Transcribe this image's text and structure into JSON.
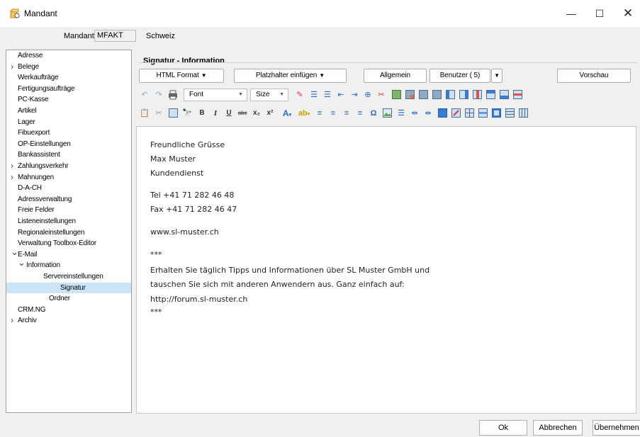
{
  "window": {
    "title": "Mandant",
    "minimize_glyph": "—",
    "maximize_glyph": "☐",
    "close_glyph": "✕"
  },
  "mandant": {
    "label": "Mandant",
    "value": "MFAKT",
    "country": "Schweiz"
  },
  "tree": {
    "items": [
      {
        "label": "Adresse",
        "expander": ""
      },
      {
        "label": "Belege",
        "expander": ">"
      },
      {
        "label": "Werkaufträge",
        "expander": ""
      },
      {
        "label": "Fertigungsaufträge",
        "expander": ""
      },
      {
        "label": "PC-Kasse",
        "expander": ""
      },
      {
        "label": "Artikel",
        "expander": ""
      },
      {
        "label": "Lager",
        "expander": ""
      },
      {
        "label": "Fibuexport",
        "expander": ""
      },
      {
        "label": "OP-Einstellungen",
        "expander": ""
      },
      {
        "label": "Bankassistent",
        "expander": ""
      },
      {
        "label": "Zahlungsverkehr",
        "expander": ">"
      },
      {
        "label": "Mahnungen",
        "expander": ">"
      },
      {
        "label": "D-A-CH",
        "expander": ""
      },
      {
        "label": "Adressverwaltung",
        "expander": ""
      },
      {
        "label": "Freie Felder",
        "expander": ""
      },
      {
        "label": "Listeneinstellungen",
        "expander": ""
      },
      {
        "label": "Regionaleinstellungen",
        "expander": ""
      },
      {
        "label": "Verwaltung Toolbox-Editor",
        "expander": ""
      },
      {
        "label": "E-Mail",
        "expander": "v"
      },
      {
        "label": "Information",
        "expander": "v"
      },
      {
        "label": "Servereinstellungen",
        "expander": ""
      },
      {
        "label": "Signatur",
        "expander": ""
      },
      {
        "label": "Ordner",
        "expander": ""
      },
      {
        "label": "CRM.NG",
        "expander": ""
      },
      {
        "label": "Archiv",
        "expander": ">"
      }
    ],
    "selected": "Signatur"
  },
  "group": {
    "title": "Signatur - Information"
  },
  "buttons": {
    "html_format": "HTML Format",
    "platzhalter": "Platzhalter einfügen",
    "allgemein": "Allgemein",
    "benutzer": "Benutzer ( 5)",
    "vorschau": "Vorschau"
  },
  "toolbar": {
    "font_combo": "Font",
    "size_combo": "Size",
    "bold": "B",
    "italic": "I",
    "underline": "U",
    "strike": "abc",
    "subscript": "x₂",
    "superscript": "x²",
    "omega": "Ω"
  },
  "editor": {
    "lines": [
      "Freundliche Grüsse",
      "Max Muster",
      "Kundendienst",
      "Tel +41 71 282 46 48",
      "Fax +41 71 282 46 47",
      "www.sl-muster.ch",
      "***",
      "Erhalten Sie täglich Tipps und Informationen über SL Muster GmbH und",
      "tauschen Sie sich mit anderen Anwendern aus. Ganz einfach auf:",
      "http://forum.sl-muster.ch",
      "***"
    ]
  },
  "footer": {
    "ok": "Ok",
    "abbrechen": "Abbrechen",
    "uebernehmen": "Übernehmen"
  },
  "colors": {
    "selection": "#cce4f7",
    "accent_orange": "#e8a23a",
    "icon_blue": "#3a7bd5",
    "icon_green": "#5aa84c",
    "icon_red": "#d9534f"
  }
}
